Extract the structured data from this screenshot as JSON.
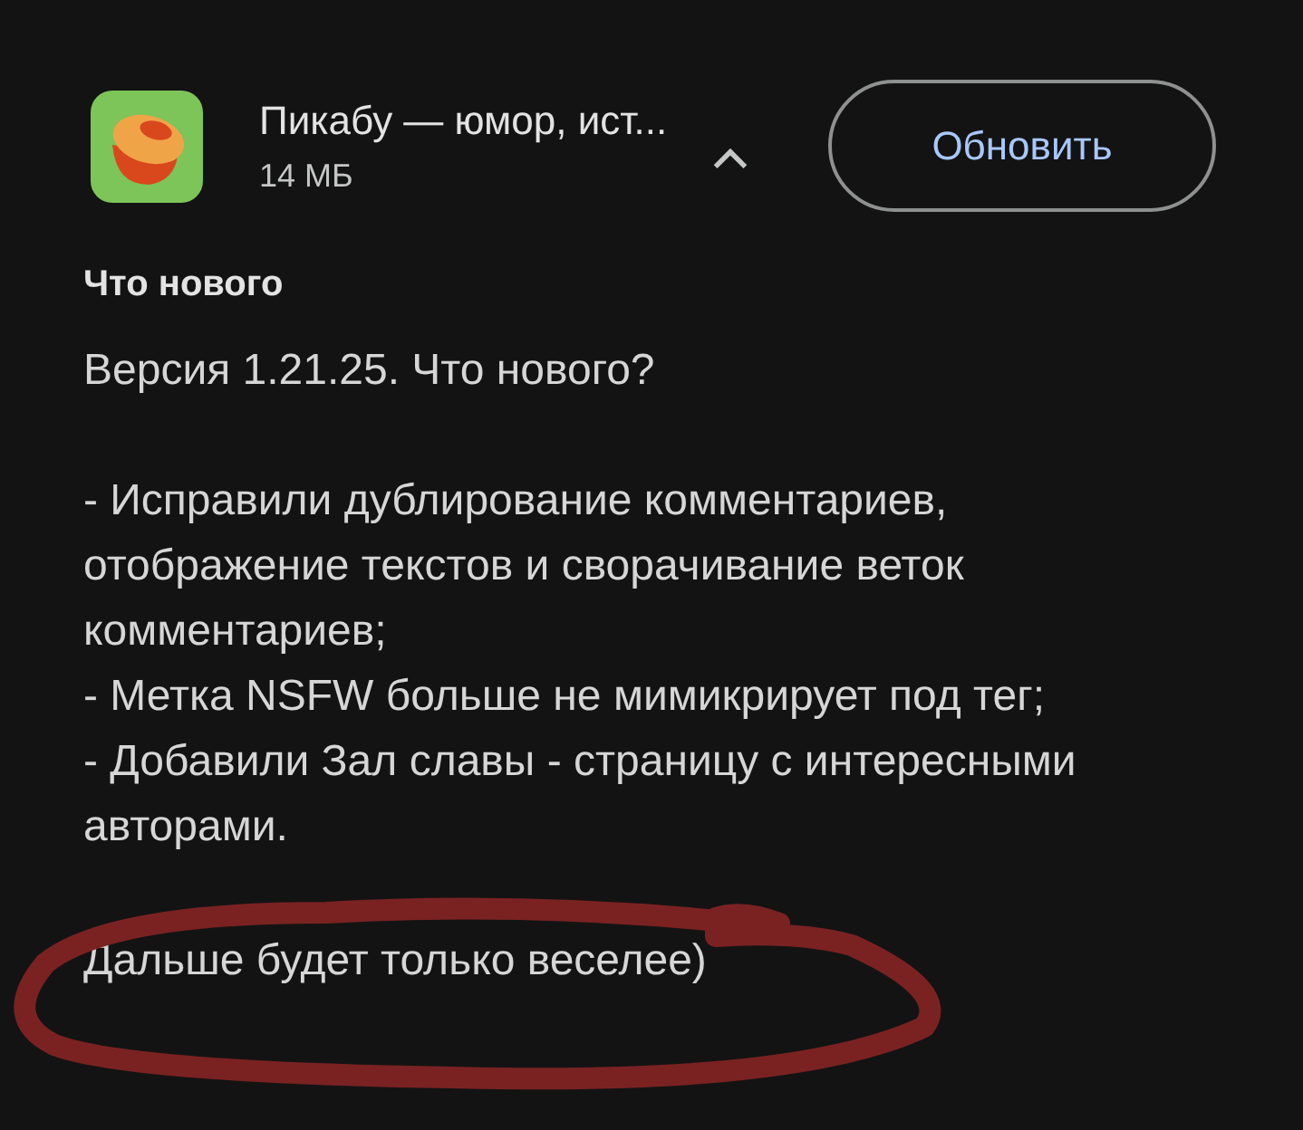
{
  "app": {
    "title": "Пикабу — юмор, ист...",
    "size": "14 МБ",
    "expanded": true,
    "button": "Обновить"
  },
  "whats_new": {
    "heading": "Что нового",
    "version": "Версия 1.21.25. Что нового?",
    "items": [
      "- Исправили дублирование комментариев, отображение текстов и сворачивание веток комментариев;",
      "- Метка NSFW больше не мимикрирует под тег;",
      "- Добавили Зал славы - страницу с интересными авторами."
    ],
    "footer": "Дальше будет только веселее)"
  }
}
